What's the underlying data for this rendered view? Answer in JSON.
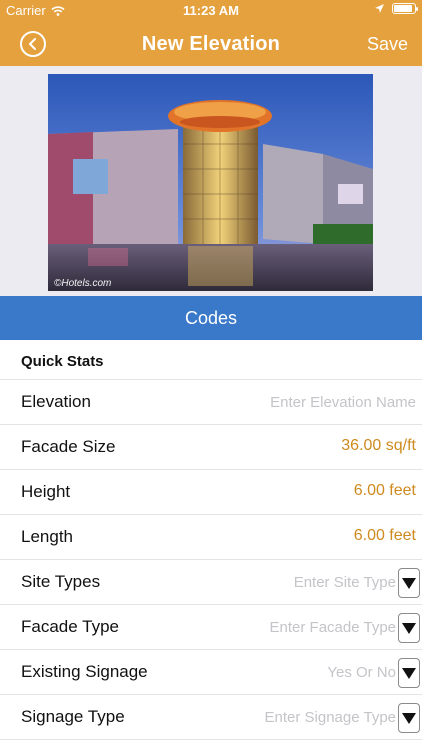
{
  "status_bar": {
    "carrier": "Carrier",
    "time": "11:23 AM",
    "battery_level": 0.9
  },
  "nav": {
    "title": "New Elevation",
    "save_label": "Save",
    "back_icon": "chevron-left-icon"
  },
  "photo": {
    "watermark": "©Hotels.com"
  },
  "codes_button": "Codes",
  "quick_stats": {
    "header": "Quick Stats",
    "rows": [
      {
        "label": "Elevation",
        "placeholder": "Enter Elevation Name"
      },
      {
        "label": "Facade Size",
        "value": "36.00 sq/ft"
      },
      {
        "label": "Height",
        "value": "6.00 feet"
      },
      {
        "label": "Length",
        "value": "6.00 feet"
      },
      {
        "label": "Site Types",
        "placeholder": "Enter Site Type"
      },
      {
        "label": "Facade Type",
        "placeholder": "Enter Facade Type"
      },
      {
        "label": "Existing Signage",
        "placeholder": "Yes Or No"
      },
      {
        "label": "Signage Type",
        "placeholder": "Enter Signage Type"
      }
    ]
  },
  "colors": {
    "accent": "#e5a13e",
    "codes_bar": "#3a78c9",
    "value_orange": "#cf8a1f"
  }
}
